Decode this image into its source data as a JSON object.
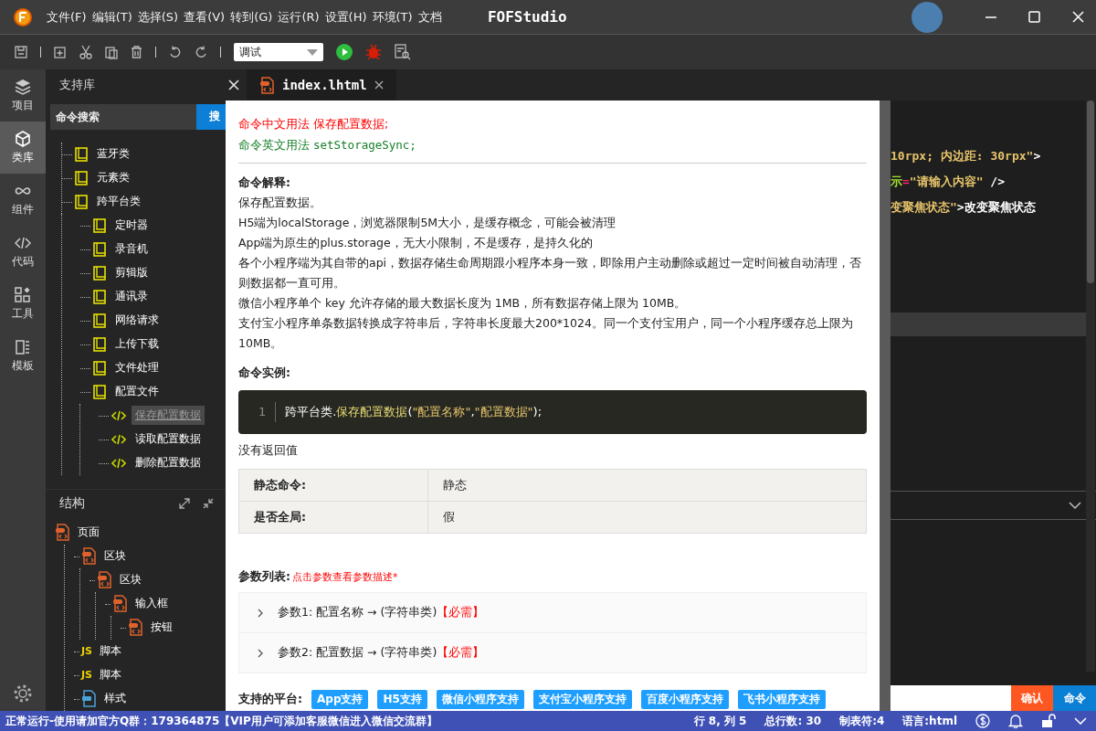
{
  "window": {
    "title": "FOFStudio",
    "menu": [
      "文件(F)",
      "编辑(T)",
      "选择(S)",
      "查看(V)",
      "转到(G)",
      "运行(R)",
      "设置(H)",
      "环境(T)",
      "文档"
    ]
  },
  "toolbar": {
    "mode_select": "调试"
  },
  "activity_bar": [
    {
      "label": "项目",
      "selected": false
    },
    {
      "label": "类库",
      "selected": true
    },
    {
      "label": "组件",
      "selected": false
    },
    {
      "label": "代码",
      "selected": false
    },
    {
      "label": "工具",
      "selected": false
    },
    {
      "label": "模板",
      "selected": false
    }
  ],
  "library": {
    "title": "支持库",
    "search_placeholder": "命令搜索",
    "search_button": "搜",
    "tree": [
      {
        "label": "蓝牙类",
        "kind": "folder",
        "selected": false
      },
      {
        "label": "元素类",
        "kind": "folder",
        "selected": false
      },
      {
        "label": "跨平台类",
        "kind": "folder",
        "selected": false,
        "children": [
          {
            "label": "定时器",
            "kind": "folder",
            "selected": false
          },
          {
            "label": "录音机",
            "kind": "folder",
            "selected": false
          },
          {
            "label": "剪辑版",
            "kind": "folder",
            "selected": false
          },
          {
            "label": "通讯录",
            "kind": "folder",
            "selected": false
          },
          {
            "label": "网络请求",
            "kind": "folder",
            "selected": false
          },
          {
            "label": "上传下载",
            "kind": "folder",
            "selected": false
          },
          {
            "label": "文件处理",
            "kind": "folder",
            "selected": false
          },
          {
            "label": "配置文件",
            "kind": "folder",
            "selected": false,
            "children": [
              {
                "label": "保存配置数据",
                "kind": "code",
                "selected": true
              },
              {
                "label": "读取配置数据",
                "kind": "code",
                "selected": false
              },
              {
                "label": "删除配置数据",
                "kind": "code",
                "selected": false
              }
            ]
          }
        ]
      }
    ]
  },
  "structure": {
    "title": "结构",
    "tree": [
      {
        "label": "页面",
        "kind": "page",
        "children": [
          {
            "label": "区块",
            "kind": "page",
            "children": [
              {
                "label": "区块",
                "kind": "page",
                "children": [
                  {
                    "label": "输入框",
                    "kind": "page",
                    "children": [
                      {
                        "label": "按钮",
                        "kind": "page"
                      }
                    ]
                  }
                ]
              }
            ]
          },
          {
            "label": "脚本",
            "kind": "script",
            "badge": "JS"
          },
          {
            "label": "脚本",
            "kind": "script",
            "badge": "JS"
          },
          {
            "label": "样式",
            "kind": "style"
          }
        ]
      }
    ]
  },
  "editor": {
    "tab": "index.lhtml",
    "code_lines": [
      [
        {
          "text": "10rpx; 内边距: 30rpx\"",
          "kind": "string"
        },
        {
          "text": ">",
          "kind": "plain"
        }
      ],
      [
        {
          "text": "示",
          "kind": "attr"
        },
        {
          "text": "=",
          "kind": "op"
        },
        {
          "text": "\"请输入内容\"",
          "kind": "string"
        },
        {
          "text": " />",
          "kind": "plain"
        }
      ],
      [
        {
          "text": "变聚焦状态\"",
          "kind": "string"
        },
        {
          "text": ">改变聚焦状态",
          "kind": "plain"
        }
      ]
    ],
    "confirm_button": "确认",
    "command_button": "命令"
  },
  "doc": {
    "usage_cn_label": "命令中文用法",
    "usage_cn": "保存配置数据;",
    "usage_en_label": "命令英文用法",
    "usage_en": "setStorageSync;",
    "explanation_heading": "命令解释:",
    "explanation": [
      "保存配置数据。",
      "H5端为localStorage，浏览器限制5M大小，是缓存概念，可能会被清理",
      "App端为原生的plus.storage，无大小限制，不是缓存，是持久化的",
      "各个小程序端为其自带的api，数据存储生命周期跟小程序本身一致，即除用户主动删除或超过一定时间被自动清理，否则数据都一直可用。",
      "微信小程序单个 key 允许存储的最大数据长度为 1MB，所有数据存储上限为 10MB。",
      "支付宝小程序单条数据转换成字符串后，字符串长度最大200*1024。同一个支付宝用户，同一个小程序缓存总上限为10MB。"
    ],
    "example_heading": "命令实例:",
    "example": {
      "line_number": "1",
      "segments": [
        {
          "text": "跨平台类",
          "kind": "plain"
        },
        {
          "text": ".",
          "kind": "plain"
        },
        {
          "text": "保存配置数据",
          "kind": "func"
        },
        {
          "text": "(",
          "kind": "plain"
        },
        {
          "text": "\"配置名称\"",
          "kind": "string"
        },
        {
          "text": ",",
          "kind": "plain"
        },
        {
          "text": "\"配置数据\"",
          "kind": "string"
        },
        {
          "text": ");",
          "kind": "plain"
        }
      ]
    },
    "return_text": "没有返回值",
    "properties": [
      {
        "name": "静态命令:",
        "value": "静态"
      },
      {
        "name": "是否全局:",
        "value": "假"
      }
    ],
    "params_heading": "参数列表:",
    "params_hint": "点击参数查看参数描述*",
    "params": [
      {
        "text": "参数1: 配置名称 → (字符串类)",
        "required": "【必需】",
        "expanded": false
      },
      {
        "text": "参数2: 配置数据 → (字符串类)",
        "required": "【必需】",
        "expanded": false
      }
    ],
    "platforms_label": "支持的平台:",
    "platforms": [
      "App支持",
      "H5支持",
      "微信小程序支持",
      "支付宝小程序支持",
      "百度小程序支持",
      "飞书小程序支持"
    ]
  },
  "status_bar": {
    "message": "正常运行-使用请加官方Q群：179364875【VIP用户可添加客服微信进入微信交流群】",
    "position": "行 8, 列 5",
    "total_lines": "总行数: 30",
    "tab_size": "制表符:4",
    "language": "语言:html"
  }
}
